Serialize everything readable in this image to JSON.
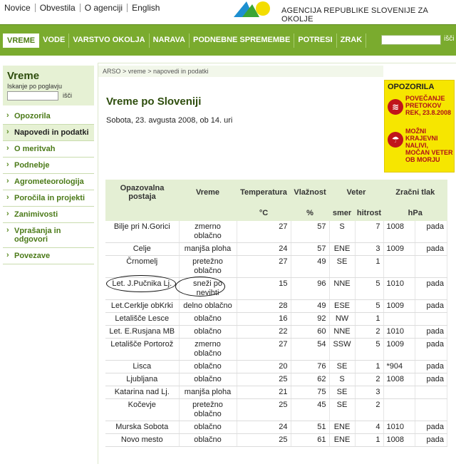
{
  "toplinks": [
    "Novice",
    "Obvestila",
    "O agenciji",
    "English"
  ],
  "agency_name": "AGENCIJA REPUBLIKE SLOVENIJE ZA OKOLJE",
  "colors": {
    "nav_green": "#7aab2e",
    "warning_yellow": "#f6e600",
    "warning_red": "#c0141b"
  },
  "nav": {
    "items": [
      "VREME",
      "VODE",
      "VARSTVO OKOLJA",
      "NARAVA",
      "PODNEBNE SPREMEMBE",
      "POTRESI",
      "ZRAK"
    ],
    "active": "VREME",
    "search_button": "išči"
  },
  "sidebar": {
    "title": "Vreme",
    "subtitle": "Iskanje po poglavju",
    "search_button": "išči",
    "items": [
      {
        "label": "Opozorila"
      },
      {
        "label": "Napovedi in podatki",
        "active": true
      },
      {
        "label": "O meritvah"
      },
      {
        "label": "Podnebje"
      },
      {
        "label": "Agrometeorologija"
      },
      {
        "label": "Poročila in projekti"
      },
      {
        "label": "Zanimivosti"
      },
      {
        "label": "Vprašanja in odgovori"
      },
      {
        "label": "Povezave"
      }
    ]
  },
  "breadcrumb": "ARSO > vreme > napovedi in podatki",
  "page": {
    "title": "Vreme po Sloveniji",
    "subtitle": "Sobota, 23. avgusta 2008, ob 14. uri"
  },
  "warnings": {
    "title": "OPOZORILA",
    "items": [
      {
        "icon": "flood-warning-icon",
        "text": "POVEČANJE PRETOKOV REK, 23.8.2008"
      },
      {
        "icon": "storm-warning-icon",
        "text": "MOŽNI KRAJEVNI NALIVI, MOČAN VETER OB MORJU"
      }
    ]
  },
  "table": {
    "headers": {
      "station": "Opazovalna postaja",
      "weather": "Vreme",
      "temperature": "Temperatura",
      "humidity": "Vlažnost",
      "wind": "Veter",
      "pressure": "Zračni tlak"
    },
    "units": {
      "temperature": "°C",
      "humidity": "%",
      "wind_dir": "smer",
      "wind_speed": "hitrost",
      "pressure": "hPa"
    },
    "rows": [
      {
        "station": "Bilje pri N.Gorici",
        "weather": "zmerno oblačno",
        "temp": "27",
        "hum": "57",
        "dir": "S",
        "speed": "7",
        "press": "1008",
        "trend": "pada"
      },
      {
        "station": "Celje",
        "weather": "manjša ploha",
        "temp": "24",
        "hum": "57",
        "dir": "ENE",
        "speed": "3",
        "press": "1009",
        "trend": "pada"
      },
      {
        "station": "Črnomelj",
        "weather": "pretežno oblačno",
        "temp": "27",
        "hum": "49",
        "dir": "SE",
        "speed": "1",
        "press": "",
        "trend": ""
      },
      {
        "station": "Let. J.Pučnika Lj.",
        "weather": "sneži po nevihti",
        "temp": "15",
        "hum": "96",
        "dir": "NNE",
        "speed": "5",
        "press": "1010",
        "trend": "pada",
        "circled": true
      },
      {
        "station": "Let.Cerklje obKrki",
        "weather": "delno oblačno",
        "temp": "28",
        "hum": "49",
        "dir": "ESE",
        "speed": "5",
        "press": "1009",
        "trend": "pada"
      },
      {
        "station": "Letališče Lesce",
        "weather": "oblačno",
        "temp": "16",
        "hum": "92",
        "dir": "NW",
        "speed": "1",
        "press": "",
        "trend": ""
      },
      {
        "station": "Let. E.Rusjana MB",
        "weather": "oblačno",
        "temp": "22",
        "hum": "60",
        "dir": "NNE",
        "speed": "2",
        "press": "1010",
        "trend": "pada"
      },
      {
        "station": "Letališče Portorož",
        "weather": "zmerno oblačno",
        "temp": "27",
        "hum": "54",
        "dir": "SSW",
        "speed": "5",
        "press": "1009",
        "trend": "pada"
      },
      {
        "station": "Lisca",
        "weather": "oblačno",
        "temp": "20",
        "hum": "76",
        "dir": "SE",
        "speed": "1",
        "press": "*904",
        "trend": "pada"
      },
      {
        "station": "Ljubljana",
        "weather": "oblačno",
        "temp": "25",
        "hum": "62",
        "dir": "S",
        "speed": "2",
        "press": "1008",
        "trend": "pada"
      },
      {
        "station": "Katarina nad Lj.",
        "weather": "manjša ploha",
        "temp": "21",
        "hum": "75",
        "dir": "SE",
        "speed": "3",
        "press": "",
        "trend": ""
      },
      {
        "station": "Kočevje",
        "weather": "pretežno oblačno",
        "temp": "25",
        "hum": "45",
        "dir": "SE",
        "speed": "2",
        "press": "",
        "trend": ""
      },
      {
        "station": "Murska Sobota",
        "weather": "oblačno",
        "temp": "24",
        "hum": "51",
        "dir": "ENE",
        "speed": "4",
        "press": "1010",
        "trend": "pada"
      },
      {
        "station": "Novo mesto",
        "weather": "oblačno",
        "temp": "25",
        "hum": "61",
        "dir": "ENE",
        "speed": "1",
        "press": "1008",
        "trend": "pada"
      }
    ]
  }
}
